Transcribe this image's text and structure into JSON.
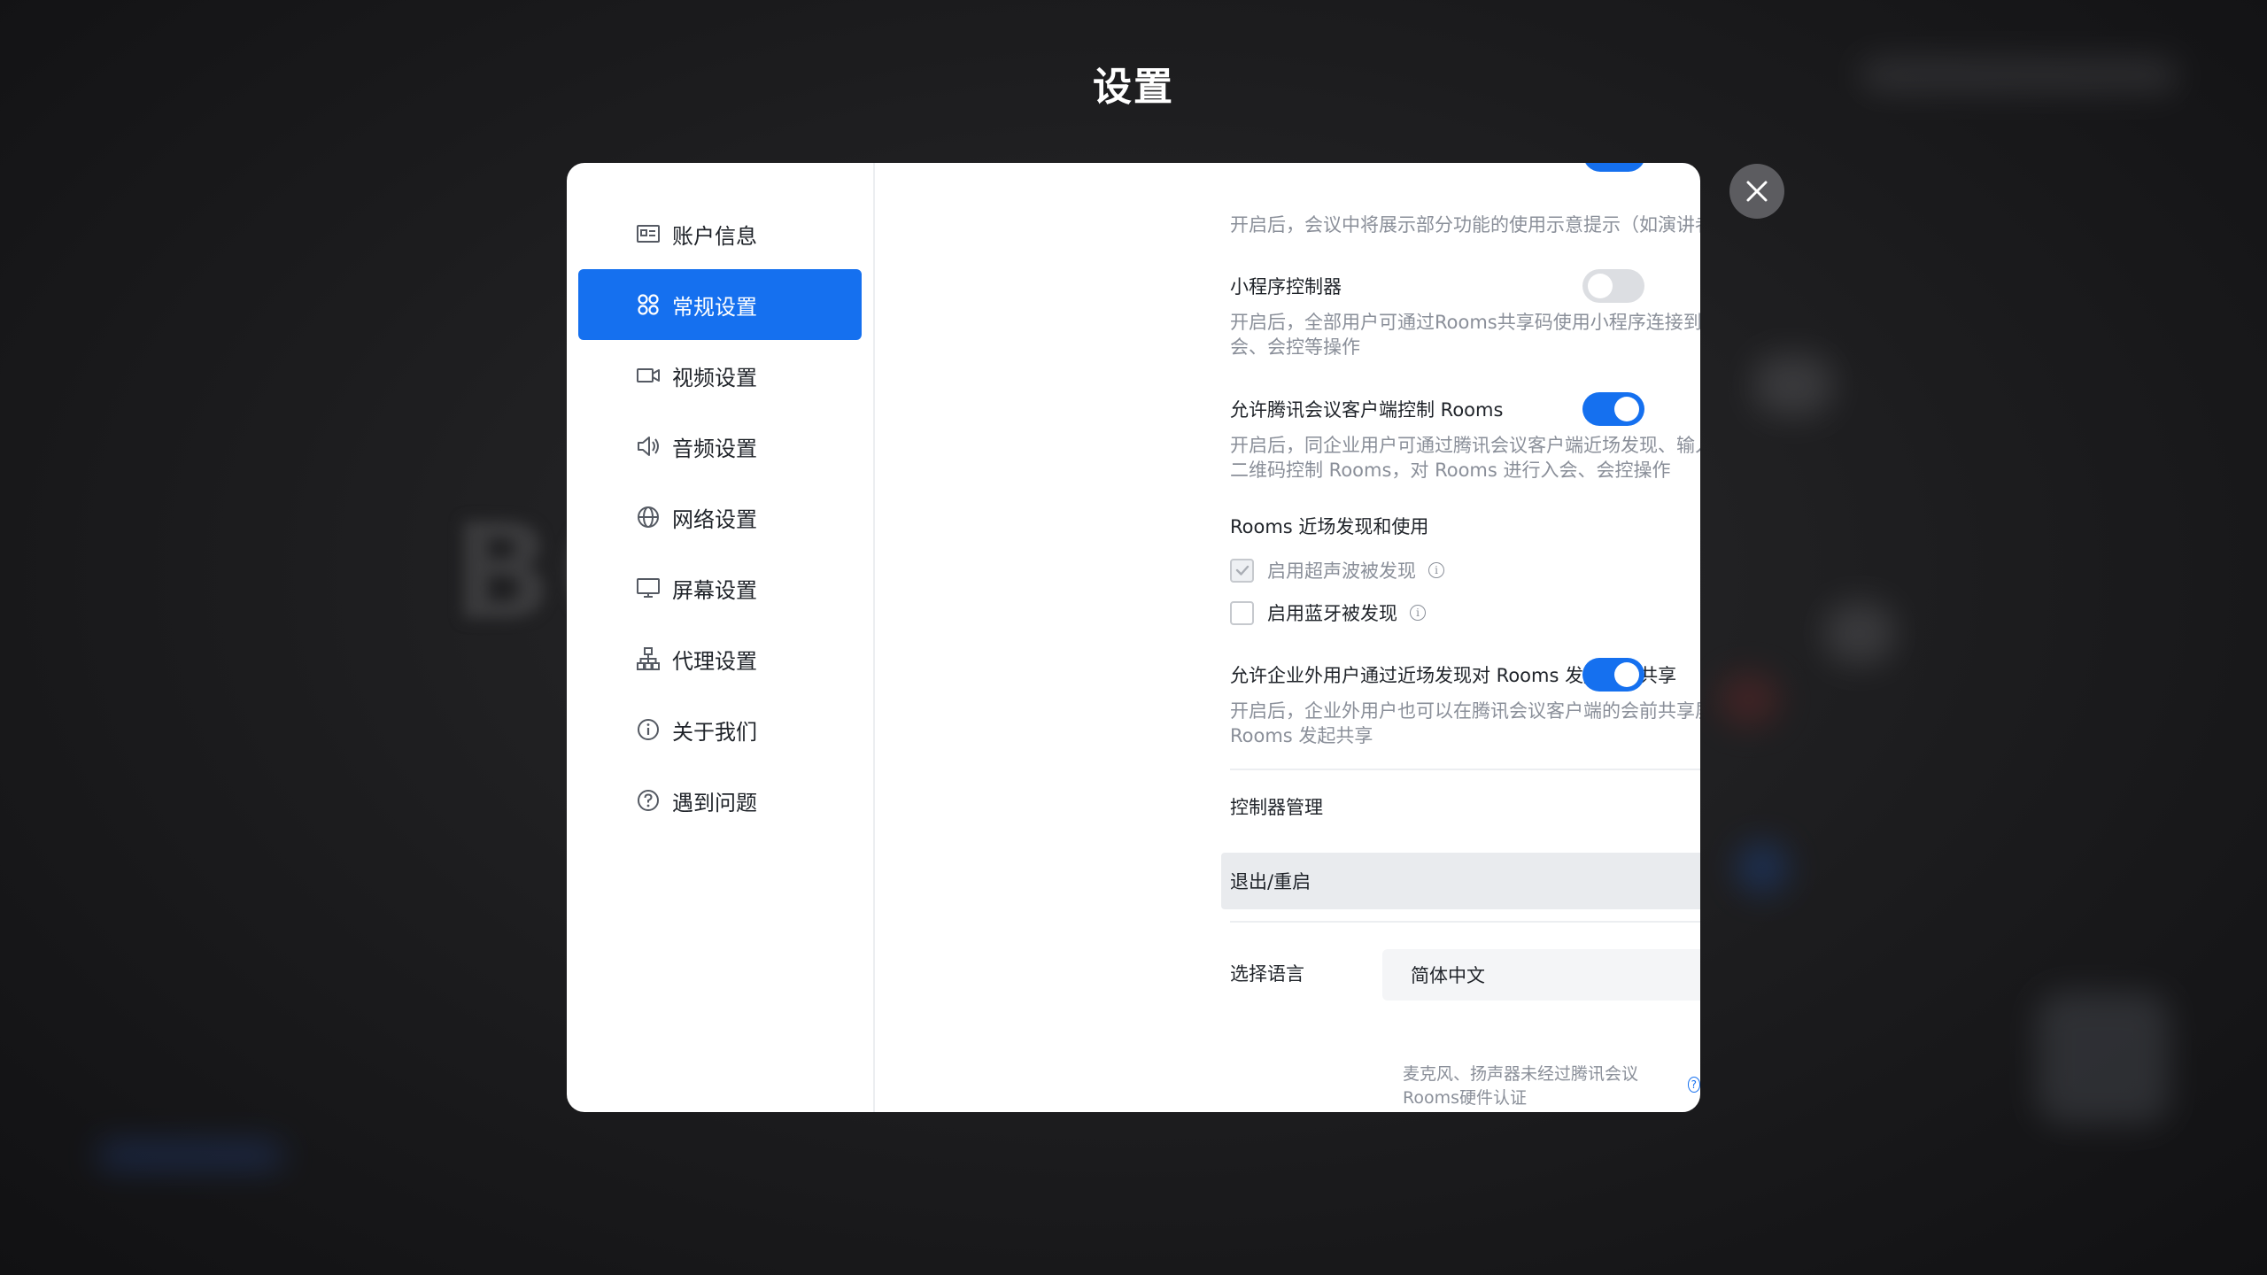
{
  "page": {
    "title": "设置"
  },
  "sidebar": {
    "items": [
      {
        "label": "账户信息",
        "icon": "id-card-icon"
      },
      {
        "label": "常规设置",
        "icon": "grid-circles-icon",
        "active": true
      },
      {
        "label": "视频设置",
        "icon": "video-camera-icon"
      },
      {
        "label": "音频设置",
        "icon": "speaker-icon"
      },
      {
        "label": "网络设置",
        "icon": "globe-icon"
      },
      {
        "label": "屏幕设置",
        "icon": "monitor-icon"
      },
      {
        "label": "代理设置",
        "icon": "network-tree-icon"
      },
      {
        "label": "关于我们",
        "icon": "info-icon"
      },
      {
        "label": "遇到问题",
        "icon": "question-icon"
      }
    ]
  },
  "settings": {
    "top_desc": "开启后，会议中将展示部分功能的使用示意提示（如演讲者布局小窗引导等）",
    "mini_program": {
      "label": "小程序控制器",
      "desc": "开启后，全部用户可通过Rooms共享码使用小程序连接到Rooms，对Rooms进行入会、会控等操作",
      "enabled": false
    },
    "client_control": {
      "label": "允许腾讯会议客户端控制 Rooms",
      "desc": "开启后，同企业用户可通过腾讯会议客户端近场发现、输入共享码或扫描 Rooms 主界面二维码控制 Rooms，对 Rooms 进行入会、会控操作",
      "enabled": true
    },
    "nearby": {
      "label": "Rooms 近场发现和使用",
      "ultrasonic_label": "启用超声波被发现",
      "ultrasonic_checked": true,
      "bluetooth_label": "启用蓝牙被发现",
      "bluetooth_checked": false
    },
    "external_share": {
      "label": "允许企业外用户通过近场发现对 Rooms 发起屏幕共享",
      "desc": "开启后，企业外用户也可以在腾讯会议客户端的会前共享屏幕功能，通过近场发现对Rooms 发起共享",
      "enabled": true
    },
    "controller_mgmt": {
      "label": "控制器管理"
    },
    "exit_restart": {
      "label": "退出/重启"
    },
    "language": {
      "label": "选择语言",
      "value": "简体中文"
    },
    "footer_note": "麦克风、扬声器未经过腾讯会议Rooms硬件认证"
  },
  "colors": {
    "accent": "#1570ef",
    "toggle_off": "#dcdee2",
    "muted_text": "#8a8f99"
  }
}
